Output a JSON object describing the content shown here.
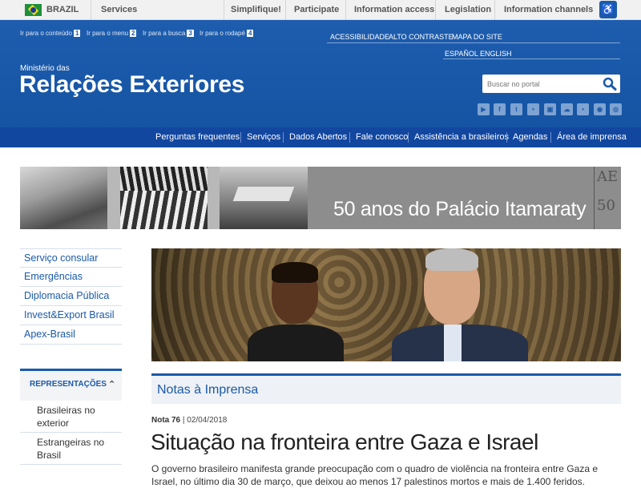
{
  "govbar": {
    "country": "BRAZIL",
    "items": [
      "Services",
      "Simplifique!",
      "Participate",
      "Information access",
      "Legislation",
      "Information channels"
    ]
  },
  "skip_links": [
    {
      "label": "Ir para o conteúdo",
      "key": "1"
    },
    {
      "label": "Ir para o menu",
      "key": "2"
    },
    {
      "label": "Ir para a busca",
      "key": "3"
    },
    {
      "label": "Ir para o rodapé",
      "key": "4"
    }
  ],
  "top_links": [
    "ACESSIBILIDADE",
    "ALTO CONTRASTE",
    "MAPA DO SITE"
  ],
  "lang_links": [
    "ESPAÑOL",
    "ENGLISH"
  ],
  "ministry": {
    "small": "Ministério das",
    "big": "Relações Exteriores"
  },
  "search": {
    "placeholder": "Buscar no portal"
  },
  "socials": [
    "youtube",
    "facebook",
    "twitter",
    "flickr",
    "instagram",
    "soundcloud",
    "tumblr",
    "rss",
    "other"
  ],
  "nav": [
    "Perguntas frequentes",
    "Serviços",
    "Dados Abertos",
    "Fale conosco",
    "Assistência a brasileiros",
    "Agendas",
    "Área de imprensa"
  ],
  "banner": {
    "title": "50 anos do Palácio Itamaraty",
    "logo": [
      "AE",
      "50"
    ]
  },
  "sidebar": {
    "links": [
      "Serviço consular",
      "Emergências",
      "Diplomacia Pública",
      "Invest&Export Brasil",
      "Apex-Brasil"
    ],
    "rep_heading": "REPRESENTAÇÕES",
    "rep_items": [
      "Brasileiras no exterior",
      "Estrangeiras no Brasil"
    ]
  },
  "main": {
    "section": "Notas à Imprensa",
    "note_label": "Nota 76",
    "date": "02/04/2018",
    "title": "Situação na fronteira entre Gaza e Israel",
    "body": "O governo brasileiro manifesta grande preocupação com o quadro de violência na fronteira entre Gaza e Israel, no último dia 30 de março, que deixou ao menos 17 palestinos mortos e mais de 1.400 feridos."
  },
  "colors": {
    "header_blue": "#1e5dae",
    "nav_blue": "#1247a0",
    "link_blue": "#1a5aa8"
  }
}
